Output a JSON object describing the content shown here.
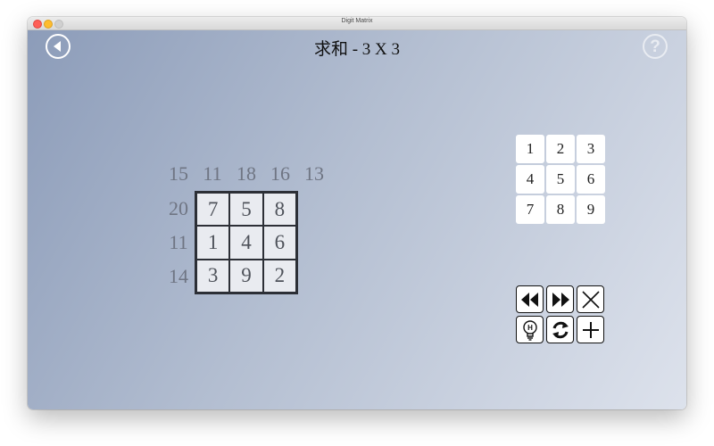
{
  "window": {
    "title": "Digit Matrix"
  },
  "header": {
    "title": "求和 - 3 X 3",
    "back_icon": "back-arrow-icon",
    "help_icon": "help-icon",
    "help_glyph": "?"
  },
  "puzzle": {
    "column_sums": [
      "15",
      "11",
      "18",
      "16",
      "13"
    ],
    "row_sums": [
      "20",
      "11",
      "14"
    ],
    "cells": [
      [
        "7",
        "5",
        "8"
      ],
      [
        "1",
        "4",
        "6"
      ],
      [
        "3",
        "9",
        "2"
      ]
    ]
  },
  "numpad": {
    "keys": [
      "1",
      "2",
      "3",
      "4",
      "5",
      "6",
      "7",
      "8",
      "9"
    ]
  },
  "controls": {
    "icons": [
      "rewind-icon",
      "fast-forward-icon",
      "close-icon",
      "hint-bulb-icon",
      "refresh-icon",
      "plus-icon"
    ],
    "hint_letter": "H"
  }
}
